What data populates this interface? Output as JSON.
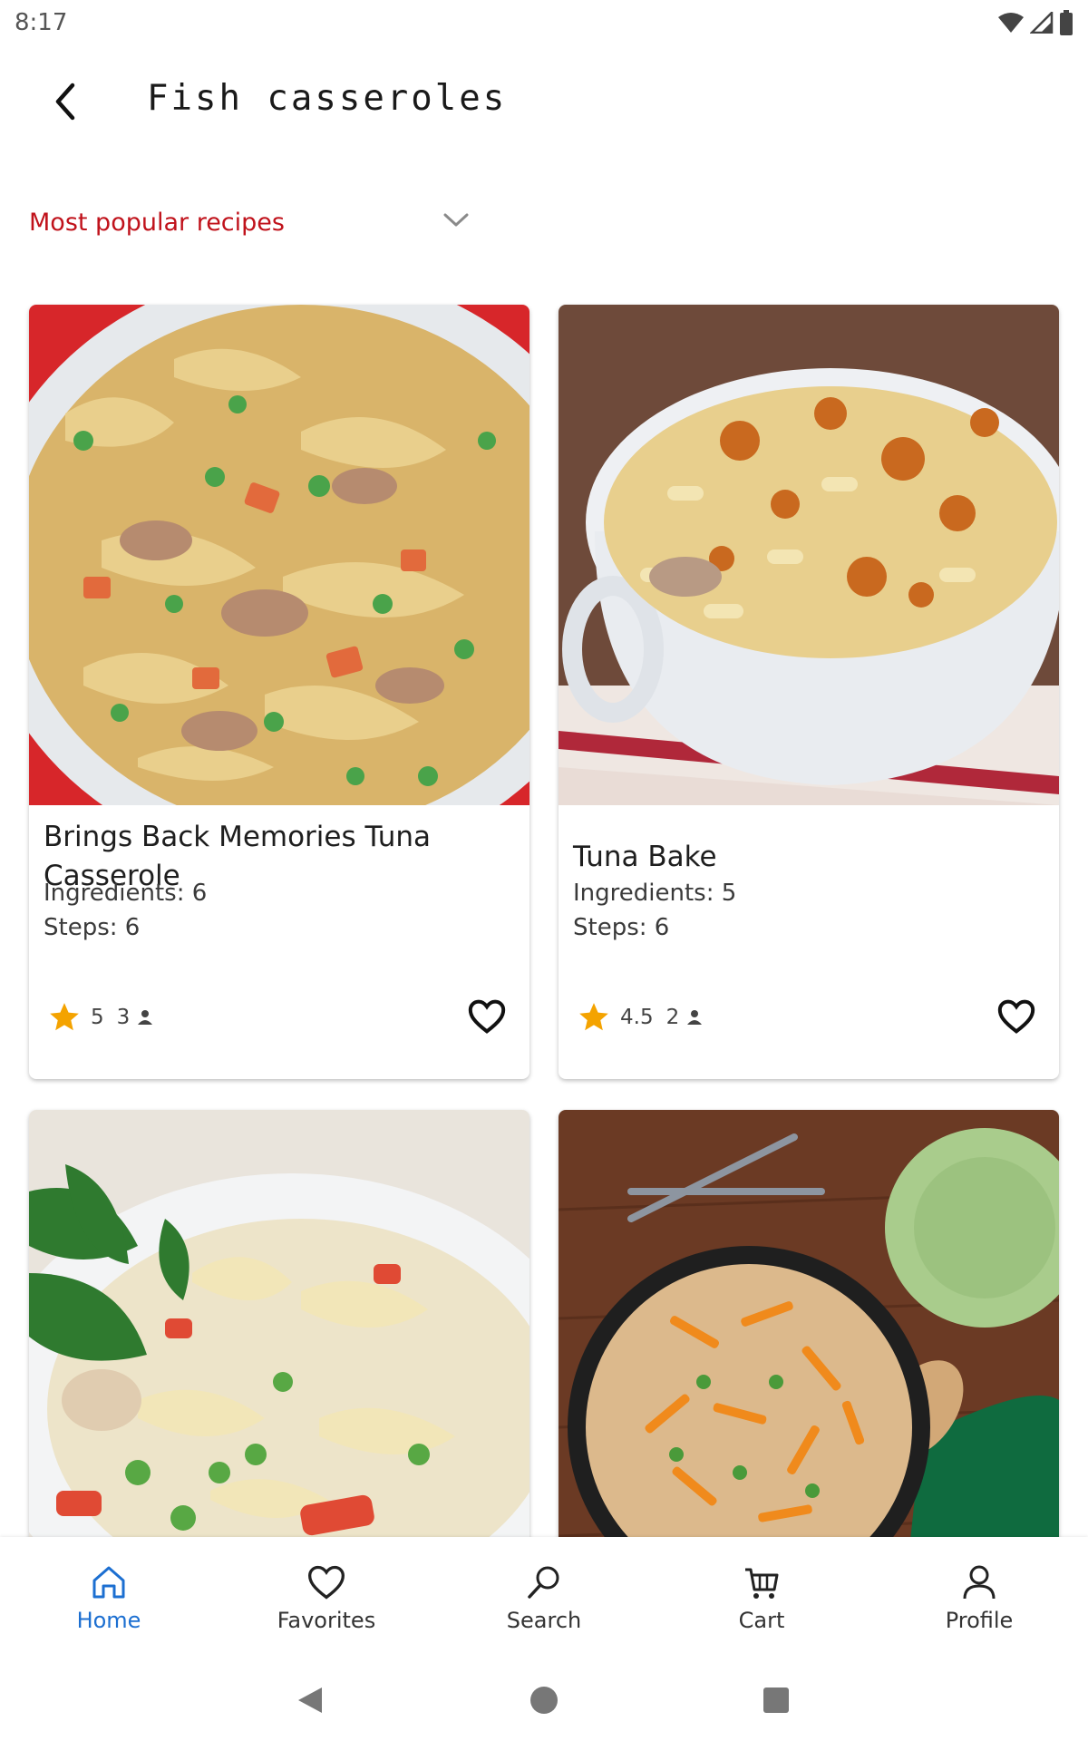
{
  "status_bar": {
    "time": "8:17"
  },
  "header": {
    "title": "Fish casseroles"
  },
  "sort": {
    "label": "Most popular recipes"
  },
  "recipes": [
    {
      "title": "Brings Back Memories Tuna Casserole",
      "ingredients": "Ingredients: 6",
      "steps": "Steps: 6",
      "rating": "5",
      "reviews": "3"
    },
    {
      "title": "Tuna Bake",
      "ingredients": "Ingredients: 5",
      "steps": "Steps: 6",
      "rating": "4.5",
      "reviews": "2"
    },
    {
      "title": "",
      "ingredients": "",
      "steps": "",
      "rating": "",
      "reviews": ""
    },
    {
      "title": "",
      "ingredients": "",
      "steps": "",
      "rating": "",
      "reviews": ""
    }
  ],
  "bottom_nav": {
    "items": [
      {
        "label": "Home",
        "icon": "home-icon",
        "active": true
      },
      {
        "label": "Favorites",
        "icon": "heart-icon",
        "active": false
      },
      {
        "label": "Search",
        "icon": "search-icon",
        "active": false
      },
      {
        "label": "Cart",
        "icon": "cart-icon",
        "active": false
      },
      {
        "label": "Profile",
        "icon": "person-icon",
        "active": false
      }
    ]
  },
  "colors": {
    "accent_red": "#c0121b",
    "active_blue": "#1c6fd1",
    "star": "#f4a300"
  }
}
